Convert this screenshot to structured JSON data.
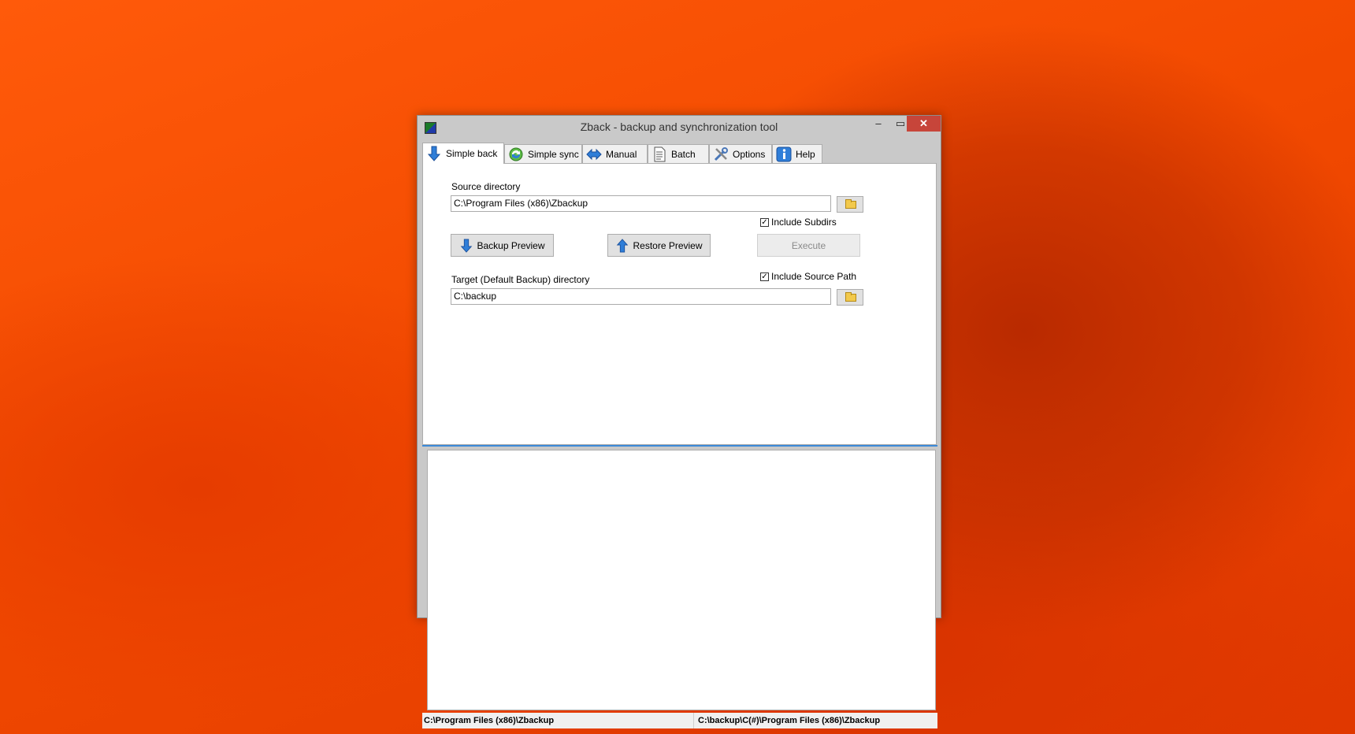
{
  "window": {
    "title": "Zback - backup and synchronization tool",
    "controls": {
      "minimize": "‒",
      "maximize": "▭",
      "close": "✕"
    }
  },
  "tabs": [
    {
      "label": "Simple back",
      "icon": "down-arrow-icon",
      "active": true
    },
    {
      "label": "Simple sync",
      "icon": "sync-icon",
      "active": false
    },
    {
      "label": "Manual",
      "icon": "double-arrow-icon",
      "active": false
    },
    {
      "label": "Batch",
      "icon": "document-icon",
      "active": false
    },
    {
      "label": "Options",
      "icon": "tools-icon",
      "active": false
    },
    {
      "label": "Help",
      "icon": "info-icon",
      "active": false
    }
  ],
  "form": {
    "source_label": "Source directory",
    "source_value": "C:\\Program Files (x86)\\Zbackup",
    "include_subdirs_label": "Include Subdirs",
    "include_subdirs_checked": true,
    "backup_preview_label": "Backup Preview",
    "restore_preview_label": "Restore Preview",
    "execute_label": "Execute",
    "target_label": "Target (Default Backup) directory",
    "include_source_path_label": "Include Source Path",
    "include_source_path_checked": true,
    "target_value": "C:\\backup",
    "check_mark": "✓"
  },
  "statusbar": {
    "left": "C:\\Program Files (x86)\\Zbackup",
    "right": "C:\\backup\\C(#)\\Program Files (x86)\\Zbackup"
  },
  "colors": {
    "accent": "#3c8ad8",
    "close_button": "#c7453a",
    "desktop": "#f24a00"
  }
}
